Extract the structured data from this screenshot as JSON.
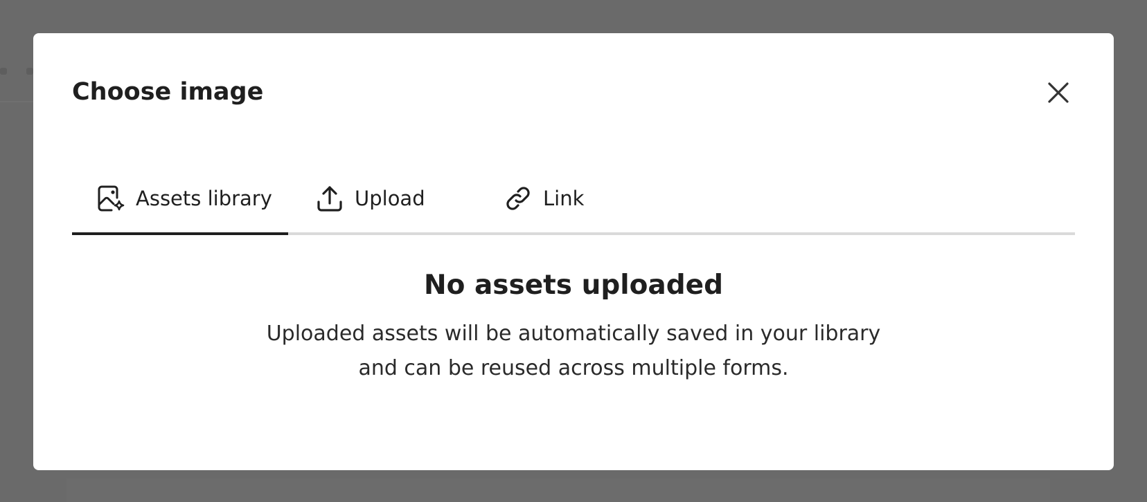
{
  "modal": {
    "title": "Choose image",
    "close_icon": "close-icon"
  },
  "tabs": [
    {
      "label": "Assets library",
      "icon": "image-sparkle-icon",
      "active": true
    },
    {
      "label": "Upload",
      "icon": "upload-icon",
      "active": false
    },
    {
      "label": "Link",
      "icon": "link-icon",
      "active": false
    }
  ],
  "empty_state": {
    "title": "No assets uploaded",
    "description_line1": "Uploaded assets will be automatically saved in your library",
    "description_line2": "and can be reused across multiple forms."
  },
  "colors": {
    "overlay": "#6a6a6a",
    "modal_bg": "#ffffff",
    "text": "#1f1f1f",
    "tab_underline_active": "#1f1f1f",
    "tab_baseline": "#dadada"
  }
}
